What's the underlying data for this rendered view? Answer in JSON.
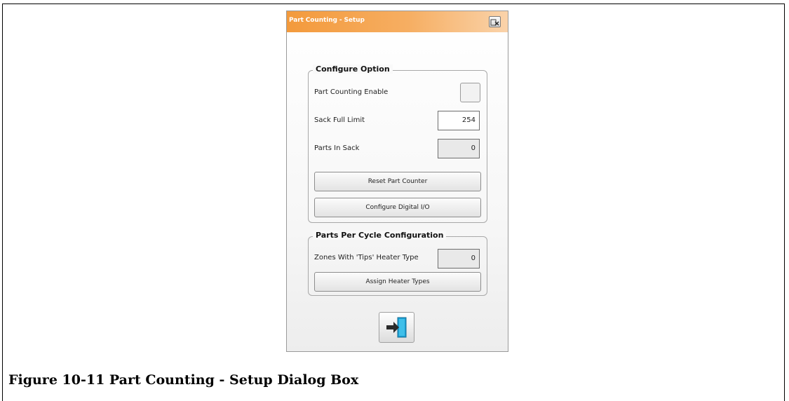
{
  "dialog": {
    "title": "Part Counting - Setup",
    "accent_color": "#f39a3c"
  },
  "configure_option": {
    "legend": "Configure Option",
    "enable_label": "Part Counting Enable",
    "enable_checked": false,
    "sack_full_limit_label": "Sack Full Limit",
    "sack_full_limit_value": "254",
    "parts_in_sack_label": "Parts In Sack",
    "parts_in_sack_value": "0",
    "reset_button": "Reset Part Counter",
    "configure_io_button": "Configure Digital I/O"
  },
  "parts_per_cycle": {
    "legend": "Parts Per Cycle Configuration",
    "zones_label": "Zones With 'Tips' Heater Type",
    "zones_value": "0",
    "assign_button": "Assign Heater Types"
  },
  "icons": {
    "close": "close-window-icon",
    "exit": "exit-door-icon"
  },
  "caption": "Figure 10-11 Part Counting - Setup Dialog Box"
}
